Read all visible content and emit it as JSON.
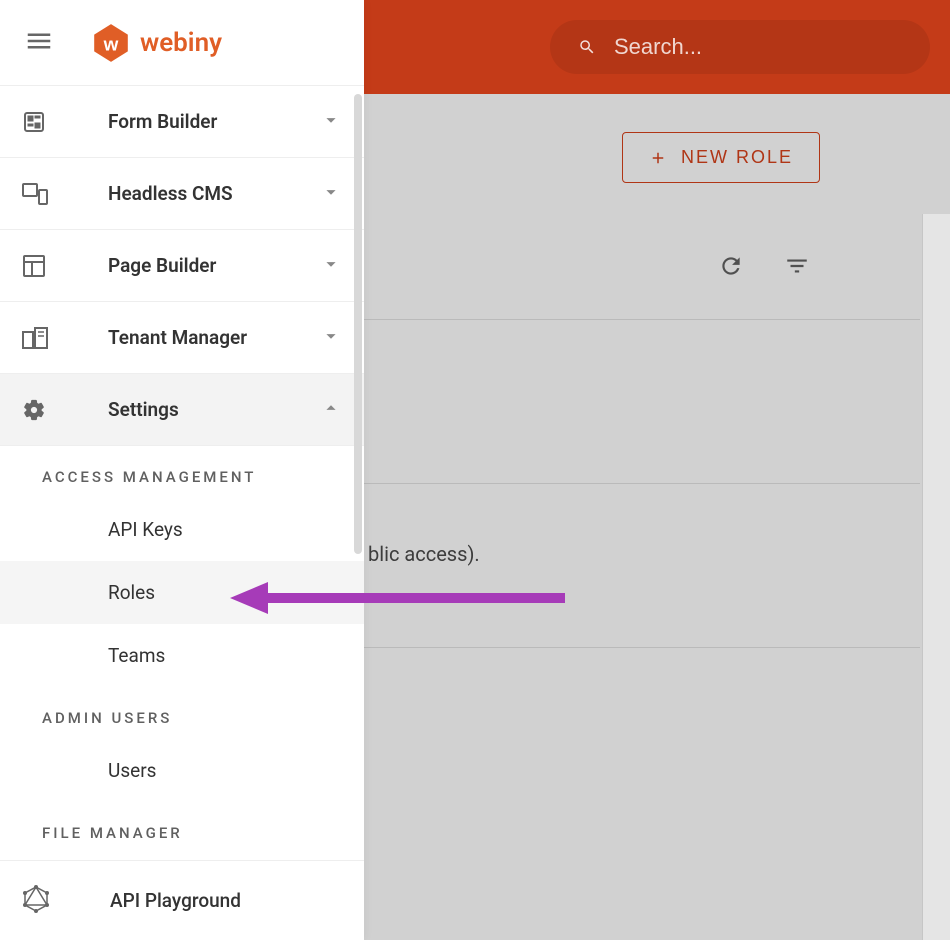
{
  "brand": {
    "name": "webiny"
  },
  "search": {
    "placeholder": "Search..."
  },
  "toolbar": {
    "new_role_label": "NEW ROLE"
  },
  "sidebar": {
    "items": [
      {
        "label": "Form Builder"
      },
      {
        "label": "Headless CMS"
      },
      {
        "label": "Page Builder"
      },
      {
        "label": "Tenant Manager"
      },
      {
        "label": "Settings"
      }
    ],
    "settings": {
      "sections": [
        {
          "title": "ACCESS MANAGEMENT",
          "items": [
            "API Keys",
            "Roles",
            "Teams"
          ]
        },
        {
          "title": "ADMIN USERS",
          "items": [
            "Users"
          ]
        },
        {
          "title": "FILE MANAGER",
          "items": []
        }
      ]
    },
    "footer": {
      "label": "API Playground"
    }
  },
  "content": {
    "partial_visible_text": "blic access)."
  }
}
